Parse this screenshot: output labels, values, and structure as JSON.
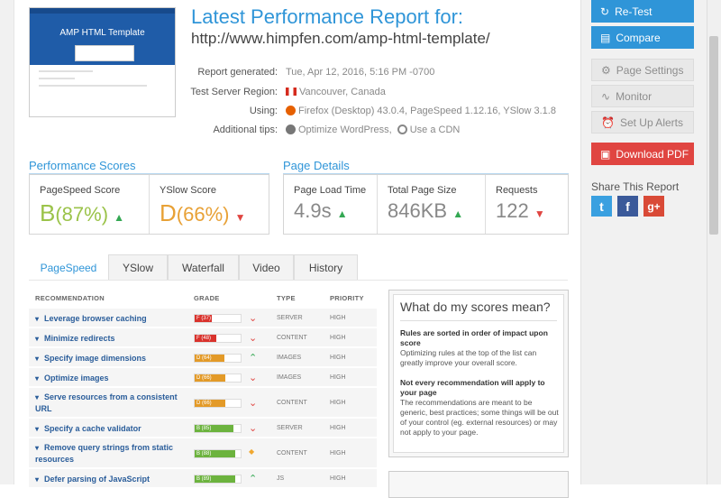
{
  "header": {
    "title": "Latest Performance Report for:",
    "url": "http://www.himpfen.com/amp-html-template/",
    "thumbnail_title": "AMP HTML Template"
  },
  "meta": {
    "report_generated_label": "Report generated:",
    "report_generated_value": "Tue, Apr 12, 2016, 5:16 PM -0700",
    "region_label": "Test Server Region:",
    "region_value": "Vancouver, Canada",
    "using_label": "Using:",
    "using_value": "Firefox (Desktop) 43.0.4, PageSpeed 1.12.16, YSlow 3.1.8",
    "tips_label": "Additional tips:",
    "tip1": "Optimize WordPress,",
    "tip2": "Use a CDN"
  },
  "performance": {
    "title": "Performance Scores",
    "pagespeed_label": "PageSpeed Score",
    "pagespeed_grade": "B",
    "pagespeed_pct": "(87%)",
    "yslow_label": "YSlow Score",
    "yslow_grade": "D",
    "yslow_pct": "(66%)"
  },
  "details": {
    "title": "Page Details",
    "load_label": "Page Load Time",
    "load_value": "4.9s",
    "size_label": "Total Page Size",
    "size_value": "846KB",
    "req_label": "Requests",
    "req_value": "122"
  },
  "tabs": [
    "PageSpeed",
    "YSlow",
    "Waterfall",
    "Video",
    "History"
  ],
  "table": {
    "headers": {
      "rec": "RECOMMENDATION",
      "grade": "GRADE",
      "type": "TYPE",
      "priority": "PRIORITY"
    },
    "rows": [
      {
        "name": "Leverage browser caching",
        "grade": "F (37)",
        "score": 37,
        "color": "#d9322c",
        "trend": "down",
        "type": "SERVER",
        "priority": "HIGH"
      },
      {
        "name": "Minimize redirects",
        "grade": "F (48)",
        "score": 48,
        "color": "#d9322c",
        "trend": "down",
        "type": "CONTENT",
        "priority": "HIGH"
      },
      {
        "name": "Specify image dimensions",
        "grade": "D (64)",
        "score": 64,
        "color": "#e39a28",
        "trend": "up",
        "type": "IMAGES",
        "priority": "HIGH"
      },
      {
        "name": "Optimize images",
        "grade": "D (66)",
        "score": 66,
        "color": "#e39a28",
        "trend": "down",
        "type": "IMAGES",
        "priority": "HIGH"
      },
      {
        "name": "Serve resources from a consistent URL",
        "grade": "D (66)",
        "score": 66,
        "color": "#e39a28",
        "trend": "down",
        "type": "CONTENT",
        "priority": "HIGH"
      },
      {
        "name": "Specify a cache validator",
        "grade": "B (85)",
        "score": 85,
        "color": "#6cb33e",
        "trend": "down",
        "type": "SERVER",
        "priority": "HIGH"
      },
      {
        "name": "Remove query strings from static resources",
        "grade": "B (88)",
        "score": 88,
        "color": "#6cb33e",
        "trend": "same",
        "type": "CONTENT",
        "priority": "HIGH"
      },
      {
        "name": "Defer parsing of JavaScript",
        "grade": "B (89)",
        "score": 89,
        "color": "#6cb33e",
        "trend": "up",
        "type": "JS",
        "priority": "HIGH"
      }
    ]
  },
  "info": {
    "title": "What do my scores mean?",
    "p1_bold": "Rules are sorted in order of impact upon score",
    "p1": "Optimizing rules at the top of the list can greatly improve your overall score.",
    "p2_bold": "Not every recommendation will apply to your page",
    "p2": "The recommendations are meant to be generic, best practices; some things will be out of your control (eg. external resources) or may not apply to your page."
  },
  "sidebar": {
    "retest": "Re-Test",
    "compare": "Compare",
    "settings": "Page Settings",
    "monitor": "Monitor",
    "alerts": "Set Up Alerts",
    "download": "Download PDF",
    "share_title": "Share This Report"
  }
}
